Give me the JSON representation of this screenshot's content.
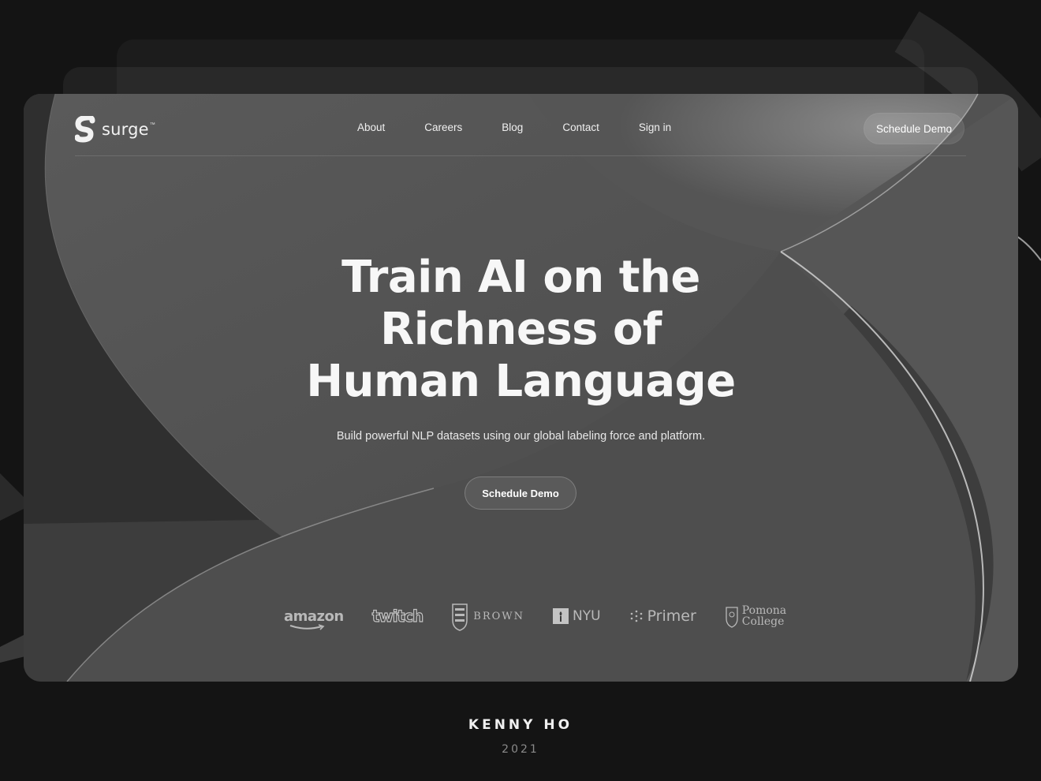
{
  "brand": {
    "name": "surge",
    "trademark": "™"
  },
  "nav": {
    "links": [
      "About",
      "Careers",
      "Blog",
      "Contact",
      "Sign in"
    ],
    "cta_label": "Schedule Demo"
  },
  "hero": {
    "title_lines": [
      "Train AI on the",
      "Richness of",
      "Human Language"
    ],
    "subtitle": "Build powerful NLP datasets using our global labeling force and platform.",
    "cta_label": "Schedule Demo"
  },
  "clients": {
    "amazon": "amazon",
    "twitch": "twitch",
    "brown": "BROWN",
    "nyu": "NYU",
    "primer": "Primer",
    "pomona_line1": "Pomona",
    "pomona_line2": "College"
  },
  "credit": {
    "author": "KENNY HO",
    "year": "2021"
  },
  "colors": {
    "background": "#141414",
    "window": "#3b3b3b",
    "text": "#ffffff",
    "muted": "#8a8a8a"
  }
}
